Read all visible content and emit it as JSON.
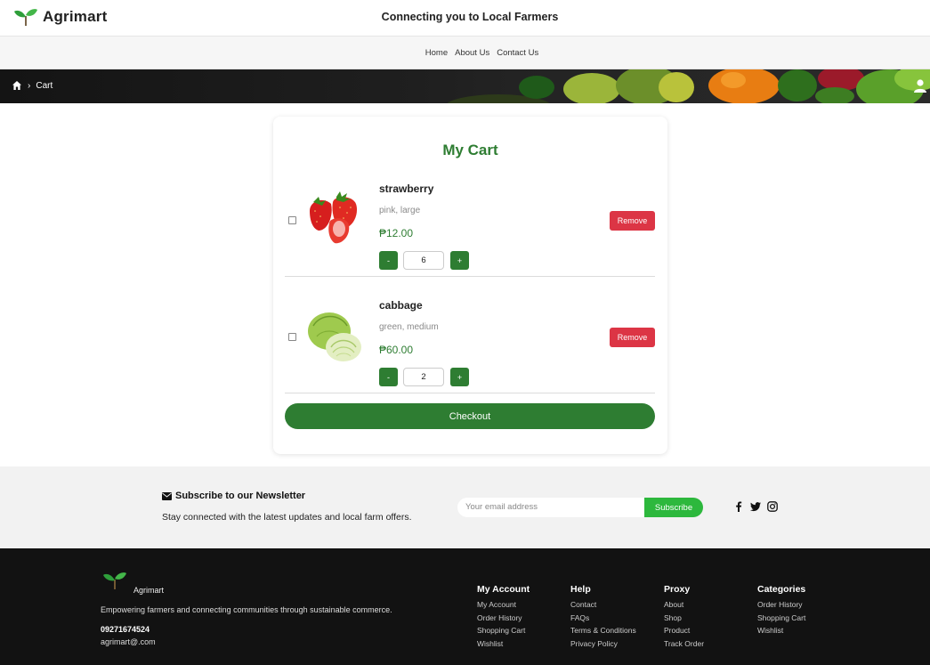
{
  "header": {
    "brand": "Agrimart",
    "tagline": "Connecting you to Local Farmers"
  },
  "nav": {
    "items": [
      "Home",
      "About Us",
      "Contact Us"
    ]
  },
  "breadcrumb": {
    "current": "Cart"
  },
  "cart": {
    "title": "My Cart",
    "items": [
      {
        "name": "strawberry",
        "variant": "pink, large",
        "price": "₱12.00",
        "quantity": "6",
        "remove_label": "Remove",
        "minus_label": "-",
        "plus_label": "+"
      },
      {
        "name": "cabbage",
        "variant": "green, medium",
        "price": "₱60.00",
        "quantity": "2",
        "remove_label": "Remove",
        "minus_label": "-",
        "plus_label": "+"
      }
    ],
    "checkout_label": "Checkout"
  },
  "newsletter": {
    "title": "Subscribe to our Newsletter",
    "description": "Stay connected with the latest updates and local farm offers.",
    "email_placeholder": "Your email address",
    "button_label": "Subscribe",
    "social_icons": [
      "facebook-icon",
      "twitter-icon",
      "instagram-icon"
    ]
  },
  "footer": {
    "brand": "Agrimart",
    "tagline": "Empowering farmers and connecting communities through sustainable commerce.",
    "phone": "09271674524",
    "email": "agrimart@.com",
    "columns": [
      {
        "title": "My Account",
        "links": [
          "My Account",
          "Order History",
          "Shopping Cart",
          "Wishlist"
        ]
      },
      {
        "title": "Help",
        "links": [
          "Contact",
          "FAQs",
          "Terms & Conditions",
          "Privacy Policy"
        ]
      },
      {
        "title": "Proxy",
        "links": [
          "About",
          "Shop",
          "Product",
          "Track Order"
        ]
      },
      {
        "title": "Categories",
        "links": [
          "Order History",
          "Shopping Cart",
          "Wishlist"
        ]
      }
    ]
  },
  "colors": {
    "brand_green": "#2e7d32",
    "remove_red": "#dc3545",
    "subscribe_green": "#2db83d",
    "footer_bg": "#121212"
  }
}
